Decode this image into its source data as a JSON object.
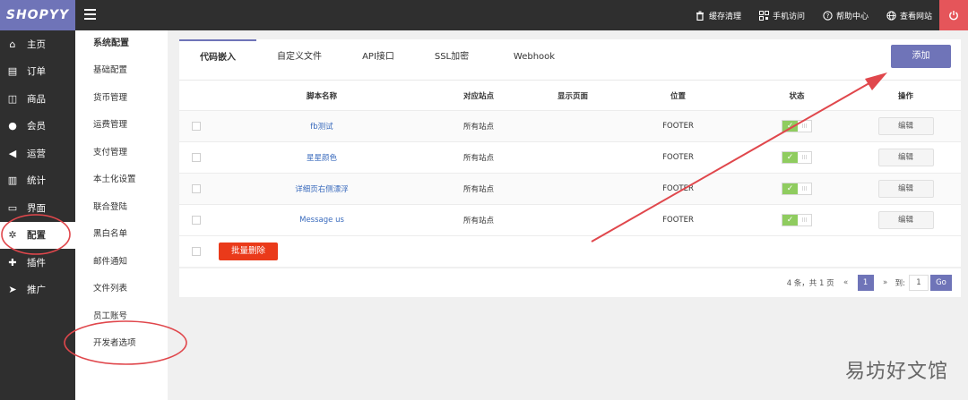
{
  "brand": {
    "logo": "SHOPYY"
  },
  "topbar": {
    "links": [
      {
        "icon": "trash-icon",
        "label": "缓存清理"
      },
      {
        "icon": "qrcode-icon",
        "label": "手机访问"
      },
      {
        "icon": "help-icon",
        "label": "帮助中心"
      },
      {
        "icon": "globe-icon",
        "label": "查看网站"
      }
    ]
  },
  "sidebar": {
    "items": [
      {
        "icon": "home-icon",
        "label": "主页"
      },
      {
        "icon": "order-icon",
        "label": "订单"
      },
      {
        "icon": "box-icon",
        "label": "商品"
      },
      {
        "icon": "member-icon",
        "label": "会员"
      },
      {
        "icon": "megaphone-icon",
        "label": "运营"
      },
      {
        "icon": "chart-icon",
        "label": "统计"
      },
      {
        "icon": "layout-icon",
        "label": "界面"
      },
      {
        "icon": "gear-icon",
        "label": "配置"
      },
      {
        "icon": "puzzle-icon",
        "label": "插件"
      },
      {
        "icon": "send-icon",
        "label": "推广"
      }
    ]
  },
  "submenu": {
    "title": "系统配置",
    "items": [
      "基础配置",
      "货币管理",
      "运费管理",
      "支付管理",
      "本土化设置",
      "联合登陆",
      "黑白名单",
      "邮件通知",
      "文件列表",
      "员工账号",
      "开发者选项"
    ]
  },
  "tabs": [
    "代码嵌入",
    "自定义文件",
    "API接口",
    "SSL加密",
    "Webhook"
  ],
  "add_label": "添加",
  "table": {
    "headers": [
      "脚本名称",
      "对应站点",
      "显示页面",
      "位置",
      "状态",
      "操作"
    ],
    "rows": [
      {
        "name": "fb测试",
        "site": "所有站点",
        "page": "",
        "position": "FOOTER",
        "action": "编辑"
      },
      {
        "name": "星星颜色",
        "site": "所有站点",
        "page": "",
        "position": "FOOTER",
        "action": "编辑"
      },
      {
        "name": "详细页右侧漂浮",
        "site": "所有站点",
        "page": "",
        "position": "FOOTER",
        "action": "编辑"
      },
      {
        "name": "Message us",
        "site": "所有站点",
        "page": "",
        "position": "FOOTER",
        "action": "编辑"
      }
    ],
    "toggle_on": "✓",
    "toggle_off": "III",
    "batch_delete": "批量删除"
  },
  "pager": {
    "summary": "4 条，共 1 页",
    "prev": "«",
    "current": "1",
    "next": "»",
    "goto": "到:",
    "input": "1",
    "go": "Go"
  },
  "watermark": "易坊好文馆",
  "colors": {
    "accent": "#6f74b8",
    "danger": "#ea3a1a",
    "annotation": "#e0474c"
  }
}
